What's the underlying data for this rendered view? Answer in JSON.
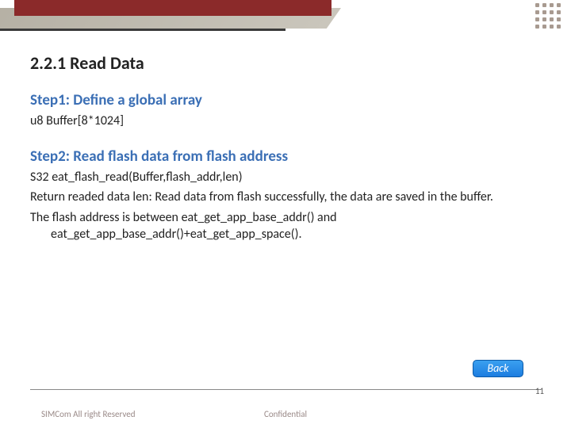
{
  "header": {
    "dot_count": 16
  },
  "section": {
    "title": "2.2.1 Read Data"
  },
  "steps": [
    {
      "heading": "Step1: Define a global array",
      "lines": [
        "u8 Buffer[8*1024]"
      ]
    },
    {
      "heading": "Step2: Read flash data from flash address",
      "lines": [
        "S32 eat_flash_read(Buffer,flash_addr,len)",
        "Return readed data len: Read data from flash successfully,  the data are saved in the buffer.",
        "The flash address is between eat_get_app_base_addr() and eat_get_app_base_addr()+eat_get_app_space()."
      ]
    }
  ],
  "buttons": {
    "back": "Back"
  },
  "footer": {
    "left": "SIMCom All right Reserved",
    "center": "Confidential",
    "page": "11"
  }
}
